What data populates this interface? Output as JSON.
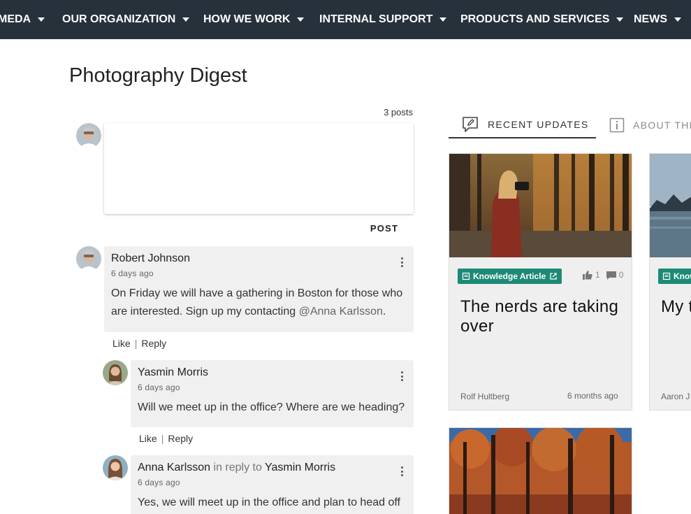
{
  "nav": {
    "items": [
      {
        "label": "MEDA"
      },
      {
        "label": "OUR ORGANIZATION"
      },
      {
        "label": "HOW WE WORK"
      },
      {
        "label": "INTERNAL SUPPORT"
      },
      {
        "label": "PRODUCTS AND SERVICES"
      },
      {
        "label": "NEWS"
      }
    ]
  },
  "page": {
    "title": "Photography Digest"
  },
  "feed": {
    "post_count": "3 posts",
    "post_button": "POST",
    "comments": [
      {
        "author": "Robert Johnson",
        "time": "6 days ago",
        "body_lines": [
          "On Friday we will have a gathering in Boston for those who",
          "are interested. Sign up my contacting "
        ],
        "mention": "@Anna Karlsson",
        "mention_suffix": ".",
        "like": "Like",
        "reply": "Reply"
      },
      {
        "author": "Yasmin Morris",
        "time": "6 days ago",
        "body": "Will we meet up in the office? Where are we heading?",
        "like": "Like",
        "reply": "Reply"
      },
      {
        "author": "Anna Karlsson",
        "in_reply_to": "in reply to",
        "reply_target": "Yasmin Morris",
        "time": "6 days ago",
        "body": "Yes, we will meet up in the office and plan to head off"
      }
    ]
  },
  "tabs": [
    {
      "label": "RECENT UPDATES",
      "icon": "edit-bubble-icon",
      "active": true
    },
    {
      "label": "ABOUT THE",
      "icon": "info-icon",
      "active": false
    }
  ],
  "cards": [
    {
      "badge": "Knowledge Article",
      "likes": "1",
      "comments": "0",
      "title_lines": [
        "The nerds are taking",
        "over"
      ],
      "author": "Rolf Hultberg",
      "time": "6 months ago"
    },
    {
      "badge": "Know",
      "title": "My t",
      "author": "Aaron J"
    }
  ],
  "colors": {
    "nav_bg": "#26313b",
    "badge_bg": "#1d8a76",
    "comment_bg": "#f0f0f0"
  }
}
